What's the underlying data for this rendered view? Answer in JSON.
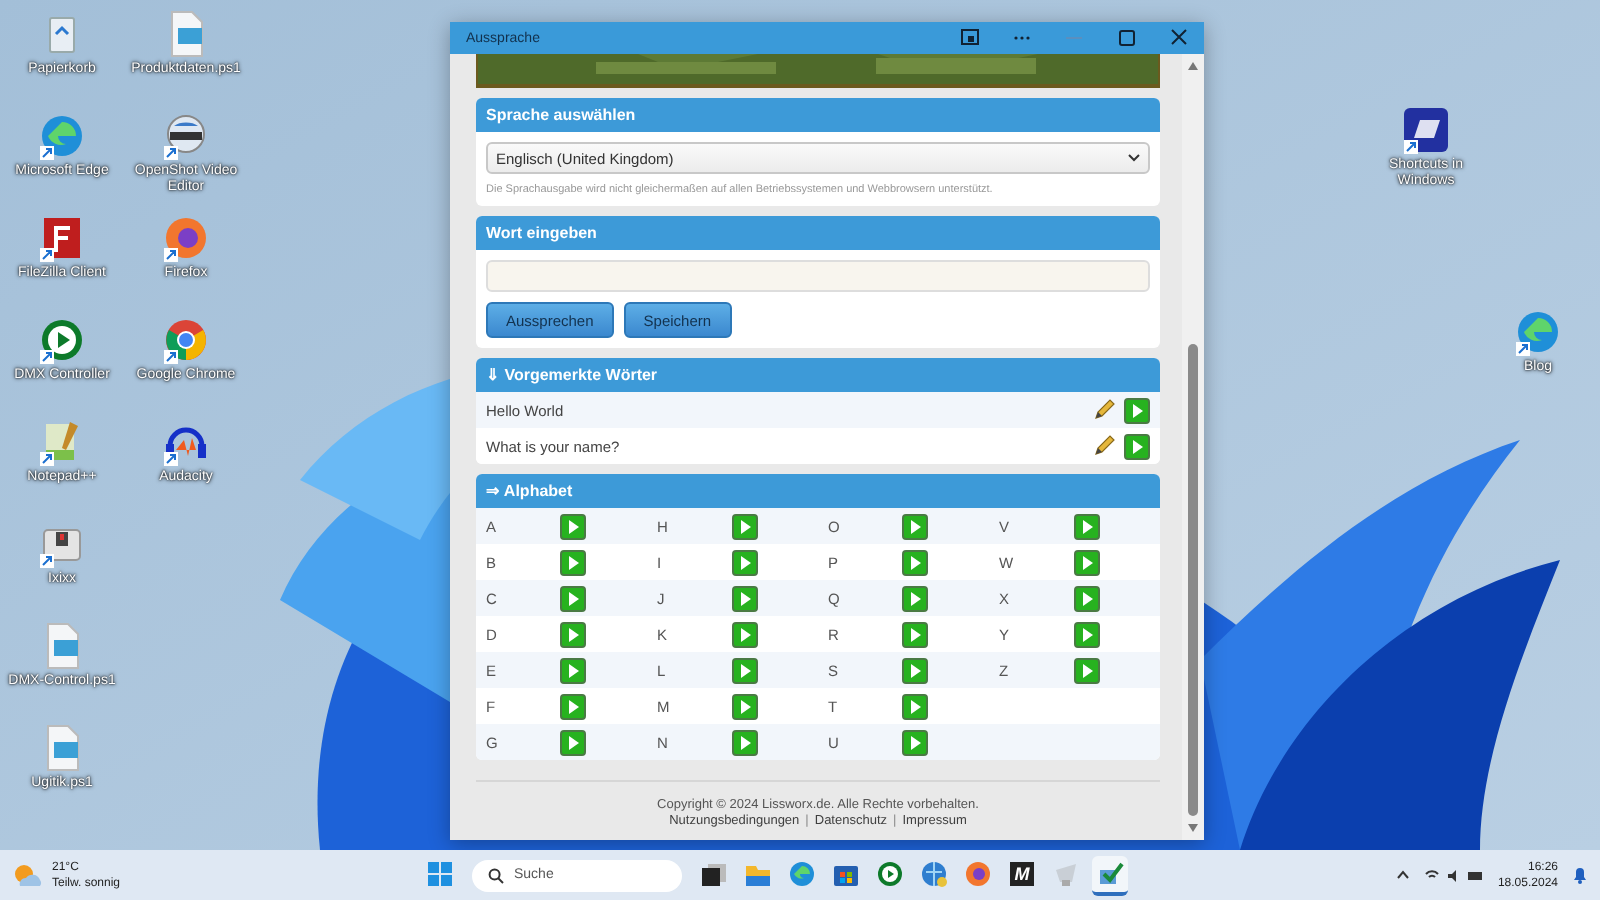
{
  "desktop": {
    "icons": [
      {
        "label": "Papierkorb",
        "kind": "trash",
        "shortcut": false
      },
      {
        "label": "Microsoft Edge",
        "kind": "edge",
        "shortcut": true
      },
      {
        "label": "FileZilla Client",
        "kind": "filezilla",
        "shortcut": true
      },
      {
        "label": "DMX Controller",
        "kind": "play",
        "shortcut": true
      },
      {
        "label": "Notepad++",
        "kind": "notepad",
        "shortcut": true
      },
      {
        "label": "Ixixx",
        "kind": "device",
        "shortcut": true
      },
      {
        "label": "DMX-Control.ps1",
        "kind": "script",
        "shortcut": false
      },
      {
        "label": "Ugitik.ps1",
        "kind": "script",
        "shortcut": false
      },
      {
        "label": "Produktdaten.ps1",
        "kind": "script",
        "shortcut": false
      },
      {
        "label": "OpenShot Video Editor",
        "kind": "openshot",
        "shortcut": true
      },
      {
        "label": "Firefox",
        "kind": "firefox",
        "shortcut": true
      },
      {
        "label": "Google Chrome",
        "kind": "chrome",
        "shortcut": true
      },
      {
        "label": "Audacity",
        "kind": "audacity",
        "shortcut": true
      }
    ],
    "icons_right": [
      {
        "label": "Shortcuts in Windows",
        "kind": "keys",
        "shortcut": true
      },
      {
        "label": "Blog",
        "kind": "edge",
        "shortcut": true
      }
    ]
  },
  "window": {
    "title": "Aussprache",
    "language": {
      "title": "Sprache auswählen",
      "value": "Englisch (United Kingdom)",
      "note": "Die Sprachausgabe wird nicht gleichermaßen auf allen Betriebssystemen und Webbrowsern unterstützt."
    },
    "word": {
      "title": "Wort eingeben",
      "buttons": [
        "Aussprechen",
        "Speichern"
      ]
    },
    "saved": {
      "title": "⇓ Vorgemerkte Wörter",
      "items": [
        "Hello World",
        "What is your name?"
      ]
    },
    "alphabet": {
      "title": "⇒ Alphabet",
      "letters": [
        "A",
        "B",
        "C",
        "D",
        "E",
        "F",
        "G",
        "H",
        "I",
        "J",
        "K",
        "L",
        "M",
        "N",
        "O",
        "P",
        "Q",
        "R",
        "S",
        "T",
        "U",
        "V",
        "W",
        "X",
        "Y",
        "Z"
      ]
    },
    "footer": {
      "copyright": "Copyright © 2024 Lissworx.de. Alle Rechte vorbehalten.",
      "links": [
        {
          "kind": "link",
          "text": "Nutzungsbedingungen"
        },
        {
          "kind": "separator",
          "text": "|"
        },
        {
          "kind": "link",
          "text": "Datenschutz"
        },
        {
          "kind": "separator",
          "text": "|"
        },
        {
          "kind": "link",
          "text": "Impressum"
        }
      ]
    }
  },
  "taskbar": {
    "weather": {
      "temp": "21°C",
      "text": "Teilw. sonnig"
    },
    "search": {
      "placeholder": "Suche"
    },
    "apps": [
      {
        "kind": "start",
        "selected": false
      },
      {
        "kind": "taskview",
        "selected": false
      },
      {
        "kind": "folder",
        "selected": false
      },
      {
        "kind": "edge",
        "selected": false
      },
      {
        "kind": "store",
        "selected": false
      },
      {
        "kind": "play",
        "selected": false
      },
      {
        "kind": "globe",
        "selected": false
      },
      {
        "kind": "firefox",
        "selected": false
      },
      {
        "kind": "letter",
        "label": "M",
        "selected": false
      },
      {
        "kind": "tool",
        "selected": false
      },
      {
        "kind": "check",
        "selected": true
      }
    ],
    "time": "16:26",
    "date": "18.05.2024"
  }
}
